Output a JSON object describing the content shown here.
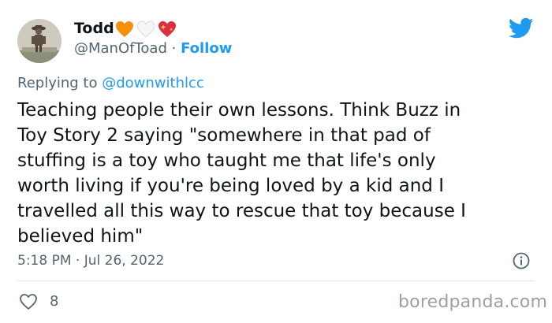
{
  "author": {
    "display_name": "Todd",
    "handle": "@ManOfToad",
    "separator": "·",
    "follow_label": "Follow",
    "name_emojis": [
      "orange-heart-icon",
      "white-heart-icon",
      "sparkling-heart-icon"
    ],
    "avatar_icon": "avatar-figure-statue"
  },
  "reply": {
    "prefix": "Replying to",
    "user": "@downwithlcc"
  },
  "tweet": {
    "text": "Teaching people their own lessons. Think Buzz in\nToy Story 2 saying \"somewhere in that pad of\nstuffing is a toy who taught me that life's only\nworth living if you're being loved by a kid and I\ntravelled all this way to rescue that toy because I\nbelieved him\"",
    "timestamp": "5:18 PM · Jul 26, 2022"
  },
  "actions": {
    "like_icon": "heart-outline-icon",
    "like_count": "8",
    "info_icon": "info-icon"
  },
  "branding": {
    "twitter_icon": "twitter-bird-icon",
    "watermark": "boredpanda.com"
  },
  "colors": {
    "link_blue": "#1d9bf0",
    "secondary_text": "#536471",
    "primary_text": "#0f1419",
    "divider": "#e1e8ed",
    "watermark_gray": "#9aa0a6"
  }
}
